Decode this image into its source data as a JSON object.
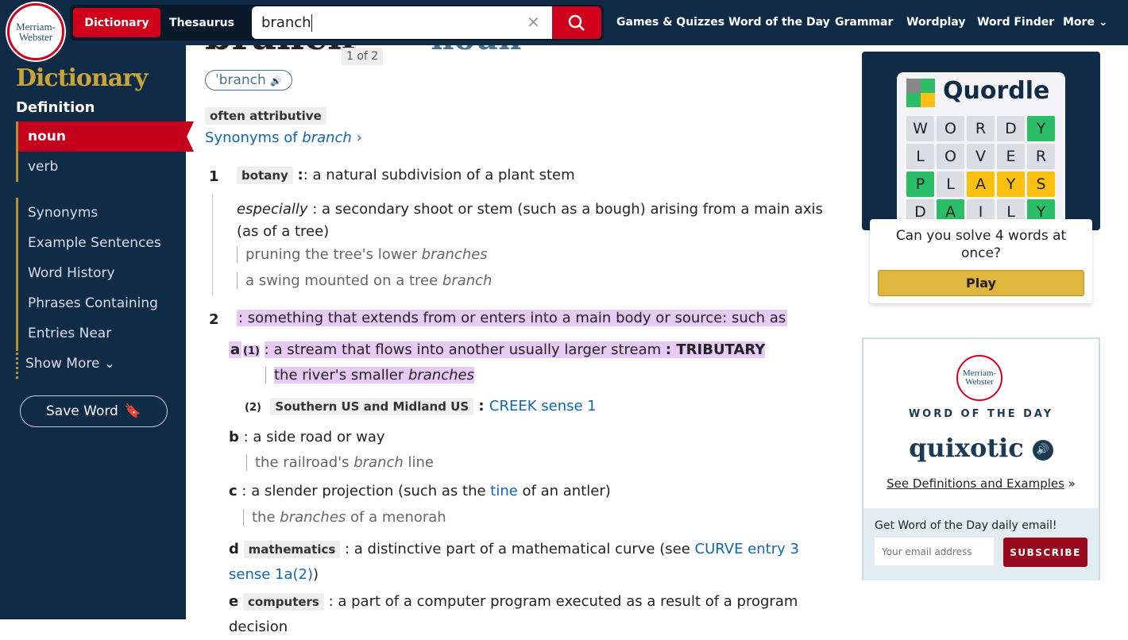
{
  "header": {
    "logo": [
      "Merriam-",
      "Webster"
    ],
    "tabs": [
      "Dictionary",
      "Thesaurus"
    ],
    "search_value": "branch",
    "nav": [
      "Games & Quizzes",
      "Word of the Day",
      "Grammar",
      "Wordplay",
      "Word Finder",
      "More"
    ]
  },
  "sidebar": {
    "title": "Dictionary",
    "section": "Definition",
    "items": [
      "noun",
      "verb",
      "Synonyms",
      "Example Sentences",
      "Word History",
      "Phrases Containing",
      "Entries Near",
      "Show More"
    ],
    "save_word": "Save Word"
  },
  "entry": {
    "headword": "branch",
    "counter": "1 of 2",
    "pos": "noun",
    "pron": "ˈbranch",
    "label": "often attributive",
    "synonyms_prefix": "Synonyms of ",
    "synonyms_word": "branch",
    "senses": {
      "s1_num": "1",
      "s1_label": "botany",
      "s1_def": ": a natural subdivision of a plant stem",
      "s1b_em": "especially",
      "s1b_def": " : a secondary shoot or stem (such as a bough) arising from a main axis (as of a tree)",
      "ex1a": "pruning the tree's lower ",
      "ex1a_em": "branches",
      "ex1b": "a swing mounted on a tree ",
      "ex1b_em": "branch",
      "s2_num": "2",
      "s2_def": ": something that extends from or enters into a main body or source: such as",
      "a": "a",
      "a1": "(1)",
      "a1_def": ": a stream that flows into another usually larger stream ",
      "a1_x": ": TRIBUTARY",
      "exa1": "the river's smaller ",
      "exa1_em": "branches",
      "a2": "(2)",
      "a2_label": "Southern US and Midland US",
      "a2_colon": " : ",
      "a2_link": "CREEK sense 1",
      "b": "b",
      "b_def": ": a side road or way",
      "exb": "the railroad's ",
      "exb_em": "branch",
      "exb2": " line",
      "c": "c",
      "c_def1": ": a slender projection (such as the ",
      "c_link": "tine",
      "c_def2": " of an antler)",
      "exc": "the ",
      "exc_em": "branches",
      "exc2": " of a menorah",
      "d": "d",
      "d_label": "mathematics",
      "d_def": " : a distinctive part of a mathematical curve (see ",
      "d_link": "CURVE entry 3 sense 1a(2)",
      "d_end": ")",
      "e": "e",
      "e_label": "computers",
      "e_def": " : a part of a computer program executed as a result of a program decision"
    }
  },
  "ad": {
    "brand": "Quordle",
    "grid": [
      [
        "W",
        "O",
        "R",
        "D",
        "Y"
      ],
      [
        "L",
        "O",
        "V",
        "E",
        "R"
      ],
      [
        "P",
        "L",
        "A",
        "Y",
        "S"
      ],
      [
        "D",
        "A",
        "I",
        "L",
        "Y"
      ]
    ],
    "colors": [
      [
        "",
        "",
        "",
        "",
        "g"
      ],
      [
        "",
        "",
        "",
        "",
        ""
      ],
      [
        "g",
        "",
        "y",
        "y",
        "y"
      ],
      [
        "",
        "g",
        "",
        "",
        "g"
      ]
    ],
    "tagline": "Can you solve 4 words at once?",
    "play": "Play"
  },
  "wotd": {
    "logo": [
      "Merriam-",
      "Webster"
    ],
    "heading": "WORD OF THE DAY",
    "word": "quixotic",
    "link": "See Definitions and Examples",
    "email_label": "Get Word of the Day daily email!",
    "email_placeholder": "Your email address",
    "subscribe": "SUBSCRIBE"
  },
  "colors": {
    "brand_red": "#d0021b",
    "navy": "#0f2b45",
    "gold": "#c9a43a",
    "highlight": "#e6c9f4",
    "link": "#0f66b8"
  }
}
